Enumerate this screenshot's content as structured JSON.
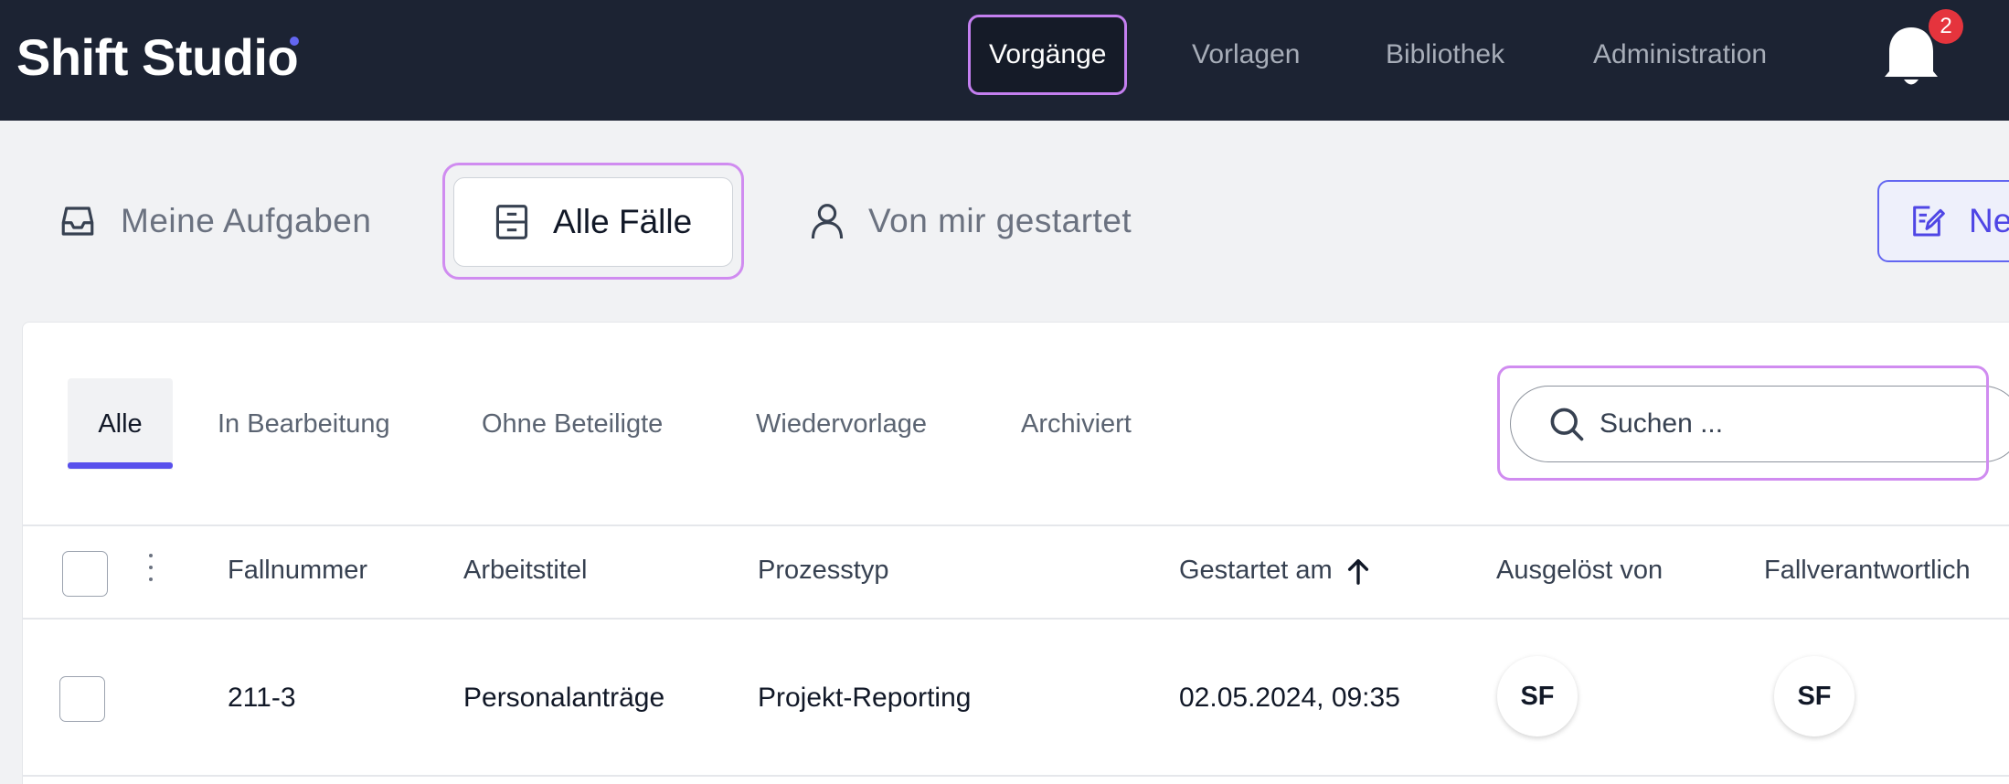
{
  "app": {
    "brand": "Shift Studio"
  },
  "nav": {
    "items": [
      "Vorgänge",
      "Vorlagen",
      "Bibliothek",
      "Administration"
    ],
    "active": "Vorgänge",
    "notifications_count": "2"
  },
  "views": {
    "items": [
      "Meine Aufgaben",
      "Alle Fälle",
      "Von mir gestartet"
    ],
    "active": "Alle Fälle",
    "new_button": "Ne"
  },
  "filters": {
    "items": [
      "Alle",
      "In Bearbeitung",
      "Ohne Beteiligte",
      "Wiedervorlage",
      "Archiviert"
    ],
    "active": "Alle"
  },
  "search": {
    "placeholder": "Suchen ..."
  },
  "table": {
    "columns": [
      "Fallnummer",
      "Arbeitstitel",
      "Prozesstyp",
      "Gestartet am",
      "Ausgelöst von",
      "Fallverantwortlich"
    ],
    "sorted_column": "Gestartet am",
    "sort_direction": "ascending",
    "rows": [
      {
        "fallnummer": "211-3",
        "arbeitstitel": "Personalanträge",
        "prozesstyp": "Projekt-Reporting",
        "gestartet_am": "02.05.2024, 09:35",
        "ausgeloest_von": "SF",
        "fallverantwortlich": "SF"
      }
    ]
  },
  "colors": {
    "topbar": "#1c2333",
    "accent": "#5850ec",
    "focus_outline": "#d08cf0",
    "badge": "#e5343d"
  }
}
